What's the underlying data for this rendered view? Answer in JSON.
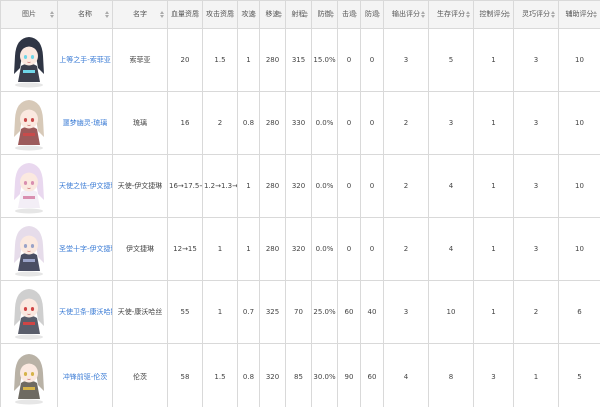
{
  "columns": [
    "图片",
    "名称",
    "名字",
    "血量资质",
    "攻击资质",
    "攻速",
    "移速",
    "射程",
    "防御",
    "击退",
    "防退",
    "输出评分",
    "生存评分",
    "控制评分",
    "灵巧评分",
    "辅助评分"
  ],
  "rows": [
    {
      "link": "上等之手-索菲亚",
      "name": "索菲亚",
      "hp": "20",
      "atk": "1.5",
      "aspd": "1",
      "spd": "280",
      "range": "315",
      "def": "15.0%",
      "kb": "0",
      "kbr": "0",
      "out": "3",
      "surv": "5",
      "ctrl": "1",
      "dex": "3",
      "sup": "10",
      "hair": "#2f3544",
      "cloth": "#3b3f4d",
      "accent": "#6fd6e8"
    },
    {
      "link": "噩梦幽灵-琉璃",
      "name": "琉璃",
      "hp": "16",
      "atk": "2",
      "aspd": "0.8",
      "spd": "280",
      "range": "330",
      "def": "0.0%",
      "kb": "0",
      "kbr": "0",
      "out": "2",
      "surv": "3",
      "ctrl": "1",
      "dex": "3",
      "sup": "10",
      "hair": "#d7c9b8",
      "cloth": "#9c5a5a",
      "accent": "#c94b4b"
    },
    {
      "link": "天使之怯-伊文捷琳",
      "name": "天使-伊文捷琳",
      "hp": "16→17.5→",
      "atk": "1.2→1.3→",
      "aspd": "1",
      "spd": "280",
      "range": "320",
      "def": "0.0%",
      "kb": "0",
      "kbr": "0",
      "out": "2",
      "surv": "4",
      "ctrl": "1",
      "dex": "3",
      "sup": "10",
      "hair": "#e9d8ef",
      "cloth": "#f3eef6",
      "accent": "#d98fb0"
    },
    {
      "link": "圣堂十字-伊文捷琳",
      "name": "伊文捷琳",
      "hp": "12→15",
      "atk": "1",
      "aspd": "1",
      "spd": "280",
      "range": "320",
      "def": "0.0%",
      "kb": "0",
      "kbr": "0",
      "out": "2",
      "surv": "4",
      "ctrl": "1",
      "dex": "3",
      "sup": "10",
      "hair": "#e6dcea",
      "cloth": "#4a4e63",
      "accent": "#9aa3c8"
    },
    {
      "link": "天使卫条-康沃哈斯",
      "name": "天使-康沃哈丝",
      "hp": "55",
      "atk": "1",
      "aspd": "0.7",
      "spd": "325",
      "range": "70",
      "def": "25.0%",
      "kb": "60",
      "kbr": "40",
      "out": "3",
      "surv": "10",
      "ctrl": "1",
      "dex": "2",
      "sup": "6",
      "hair": "#cfcfcf",
      "cloth": "#5a5e6b",
      "accent": "#d04545"
    },
    {
      "link": "冲锋前驱-伦茨",
      "name": "伦茨",
      "hp": "58",
      "atk": "1.5",
      "aspd": "0.8",
      "spd": "320",
      "range": "85",
      "def": "30.0%",
      "kb": "90",
      "kbr": "60",
      "out": "4",
      "surv": "8",
      "ctrl": "3",
      "dex": "1",
      "sup": "5",
      "hair": "#b9b2a6",
      "cloth": "#6e6a62",
      "accent": "#d6b44a"
    }
  ]
}
